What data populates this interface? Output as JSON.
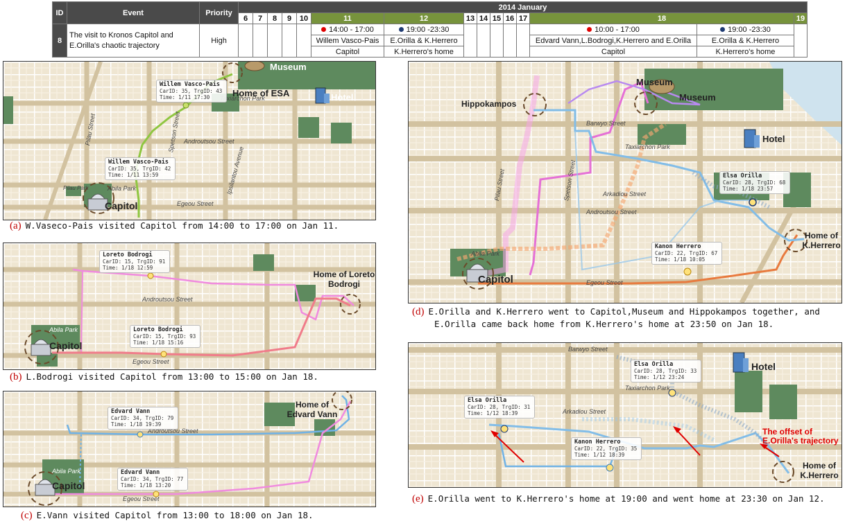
{
  "table": {
    "headers": {
      "id": "ID",
      "event": "Event",
      "priority": "Priority",
      "month": "2014 January"
    },
    "days": [
      "6",
      "7",
      "8",
      "9",
      "10",
      "11",
      "12",
      "13",
      "14",
      "15",
      "16",
      "17",
      "18",
      "19"
    ],
    "row": {
      "id": "8",
      "event": "The visit to Kronos Capitol and E.Orilla's chaotic trajectory",
      "priority": "High"
    },
    "d11": {
      "time": "14:00 - 17:00",
      "person": "Willem Vasco-Pais",
      "place": "Capitol"
    },
    "d12": {
      "time": "19:00 -23:30",
      "person": "E.Orilla & K.Herrero",
      "place": "K.Herrero's home"
    },
    "d18a": {
      "time": "10:00 - 17:00",
      "person": "Edvard Vann,L.Bodrogi,K.Herrero and E.Orilla",
      "place": "Capitol"
    },
    "d18b": {
      "time": "19:00 -23:30",
      "person": "E.Orilla & K.Herrero",
      "place": "K.Herrero's home"
    },
    "colors": {
      "dark": "#4a4a4a",
      "green": "#77933c",
      "red_dot": "#e00000",
      "blue_dot": "#1f3b73"
    }
  },
  "panel_a": {
    "caption_label": "(a)",
    "caption": "W.Vaseco-Pais visited Capitol from 14:00 to 17:00 on Jan 11.",
    "places": {
      "capitol": "Capitol",
      "home": "Home of ESA",
      "museum": "Museum",
      "hotel": "Hotel"
    },
    "streets": {
      "s1": "Abila Park",
      "s2": "Pilau Park",
      "s3": "Taxiarchon Park",
      "s4": "Spetson Street",
      "s5": "Ipsilantou Avenue",
      "s6": "Androutsou Street",
      "s7": "Pilau Street",
      "s8": "Egeou Street"
    },
    "tips": [
      {
        "name": "Willem Vasco-Pais",
        "ids": "CarID: 35, TrgID: 43",
        "time": "Time: 1/11 17:30"
      },
      {
        "name": "Willem Vasco-Pais",
        "ids": "CarID: 35, TrgID: 42",
        "time": "Time: 1/11 13:59"
      }
    ]
  },
  "panel_b": {
    "caption_label": "(b)",
    "caption": "L.Bodrogi visited Capitol from 13:00 to 15:00 on Jan 18.",
    "places": {
      "capitol": "Capitol",
      "home": "Home of Loreto Bodrogi"
    },
    "streets": {
      "s1": "Abila Park",
      "s2": "Androutsou Street",
      "s3": "Egeou Street"
    },
    "tips": [
      {
        "name": "Loreto Bodrogi",
        "ids": "CarID: 15, TrgID: 91",
        "time": "Time: 1/18 12:59"
      },
      {
        "name": "Loreto Bodrogi",
        "ids": "CarID: 15, TrgID: 93",
        "time": "Time: 1/18 15:16"
      }
    ]
  },
  "panel_c": {
    "caption_label": "(c)",
    "caption": "E.Vann visited Capitol from 13:00 to 18:00 on Jan 18.",
    "places": {
      "capitol": "Capitol",
      "home": "Home of Edvard Vann"
    },
    "streets": {
      "s1": "Abila Park",
      "s2": "Androutsou Street",
      "s3": "Egeou Street"
    },
    "tips": [
      {
        "name": "Edvard Vann",
        "ids": "CarID: 34, TrgID: 79",
        "time": "Time: 1/18 19:39"
      },
      {
        "name": "Edvard Vann",
        "ids": "CarID: 34, TrgID: 77",
        "time": "Time: 1/18 13:20"
      }
    ]
  },
  "panel_d": {
    "caption_label": "(d)",
    "caption_line1": "E.Orilla and K.Herrero went to Capitol,Museum and Hippokampos together, and",
    "caption_line2": "E.Orilla came back home from K.Herrero's home at 23:50 on Jan 18.",
    "places": {
      "capitol": "Capitol",
      "museum": "Museum",
      "museum2": "Museum",
      "hotel": "Hotel",
      "hippo": "Hippokampos",
      "home": "Home of K.Herrero"
    },
    "streets": {
      "s1": "Barwyo Street",
      "s2": "Arkadiou Street",
      "s3": "Androutsou Street",
      "s4": "Egeou Street",
      "s5": "Pilau Street",
      "s6": "Spetson Street",
      "s7": "Taxiarchon Park",
      "s8": "Abila Park"
    },
    "tips": [
      {
        "name": "Elsa Orilla",
        "ids": "CarID: 28, TrgID: 68",
        "time": "Time: 1/18 23:57"
      },
      {
        "name": "Kanon Herrero",
        "ids": "CarID: 22, TrgID: 67",
        "time": "Time: 1/18 10:05"
      }
    ]
  },
  "panel_e": {
    "caption_label": "(e)",
    "caption": "E.Orilla went to K.Herrero's home at 19:00 and went home at 23:30 on Jan 12.",
    "places": {
      "hotel": "Hotel",
      "home": "Home of K.Herrero"
    },
    "note": "The offset of E.Orilla's trajectory",
    "streets": {
      "s1": "Barwyo Street",
      "s2": "Arkadiou Street",
      "s3": "Taxiarchon Park"
    },
    "tips": [
      {
        "name": "Elsa Orilla",
        "ids": "CarID: 28, TrgID: 33",
        "time": "Time: 1/12 23:24"
      },
      {
        "name": "Elsa Orilla",
        "ids": "CarID: 28, TrgID: 31",
        "time": "Time: 1/12 18:39"
      },
      {
        "name": "Kanon Herrero",
        "ids": "CarID: 22, TrgID: 35",
        "time": "Time: 1/12 18:39"
      }
    ]
  }
}
